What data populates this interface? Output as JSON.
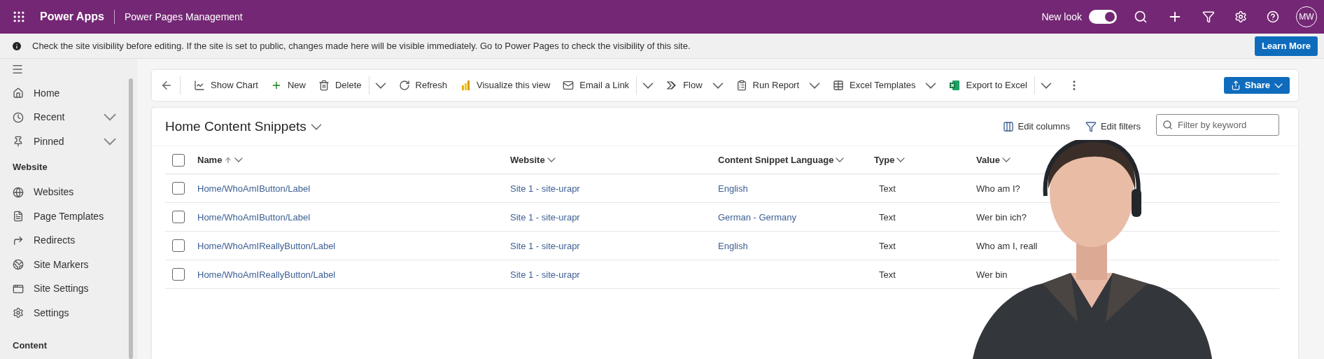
{
  "top_bar": {
    "app_name": "Power Apps",
    "page_title": "Power Pages Management",
    "new_look": {
      "label": "New look",
      "on": true
    },
    "avatar": "MW"
  },
  "notice": {
    "text": "Check the site visibility before editing. If the site is set to public, changes made here will be visible immediately. Go to Power Pages to check the visibility of this site.",
    "button": "Learn More"
  },
  "sidebar": {
    "items": [
      {
        "label": "Home",
        "expandable": false
      },
      {
        "label": "Recent",
        "expandable": true
      },
      {
        "label": "Pinned",
        "expandable": true
      }
    ],
    "sections": [
      {
        "title": "Website",
        "items": [
          {
            "label": "Websites"
          },
          {
            "label": "Page Templates"
          },
          {
            "label": "Redirects"
          },
          {
            "label": "Site Markers"
          },
          {
            "label": "Site Settings"
          },
          {
            "label": "Settings"
          }
        ]
      },
      {
        "title": "Content"
      }
    ]
  },
  "toolbar": {
    "items": [
      {
        "label": "Show Chart",
        "split": false,
        "caret": false
      },
      {
        "label": "New",
        "split": false,
        "caret": false
      },
      {
        "label": "Delete",
        "split": true,
        "caret": false
      },
      {
        "label": "Refresh",
        "split": false,
        "caret": false
      },
      {
        "label": "Visualize this view",
        "split": false,
        "caret": false
      },
      {
        "label": "Email a Link",
        "split": true,
        "caret": false
      },
      {
        "label": "Flow",
        "split": false,
        "caret": true
      },
      {
        "label": "Run Report",
        "split": false,
        "caret": true
      },
      {
        "label": "Excel Templates",
        "split": false,
        "caret": true
      },
      {
        "label": "Export to Excel",
        "split": true,
        "caret": false
      }
    ],
    "share": "Share"
  },
  "grid": {
    "title": "Home Content Snippets",
    "actions": [
      "Edit columns",
      "Edit filters"
    ],
    "search": {
      "placeholder": "Filter by keyword"
    },
    "all_checked": false,
    "columns": [
      {
        "label": "Name",
        "sorted": true
      },
      {
        "label": "Website",
        "sorted": false
      },
      {
        "label": "Content Snippet Language",
        "sorted": false
      },
      {
        "label": "Type",
        "sorted": false
      },
      {
        "label": "Value",
        "sorted": false
      }
    ],
    "rows": [
      {
        "checked": false,
        "name": "Home/WhoAmIButton/Label",
        "website": "Site 1 - site-urapr",
        "language": "English",
        "type": "Text",
        "value": "Who am I?"
      },
      {
        "checked": false,
        "name": "Home/WhoAmIButton/Label",
        "website": "Site 1 - site-urapr",
        "language": "German - Germany",
        "type": "Text",
        "value": "Wer bin ich?"
      },
      {
        "checked": false,
        "name": "Home/WhoAmIReallyButton/Label",
        "website": "Site 1 - site-urapr",
        "language": "English",
        "type": "Text",
        "value": "Who am I, reall"
      },
      {
        "checked": false,
        "name": "Home/WhoAmIReallyButton/Label",
        "website": "Site 1 - site-urapr",
        "type": "Text",
        "value": "Wer bin"
      }
    ]
  }
}
